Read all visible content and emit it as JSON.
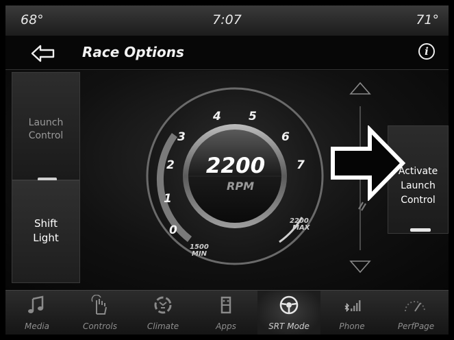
{
  "status": {
    "temp_left": "68°",
    "time": "7:07",
    "temp_right": "71°"
  },
  "header": {
    "title": "Race Options",
    "info_icon": "info-icon",
    "back_icon": "back-arrow-icon"
  },
  "tiles": {
    "launch": {
      "line1": "Launch",
      "line2": "Control"
    },
    "shift": {
      "line1": "Shift",
      "line2": "Light"
    },
    "activate": {
      "line1": "Activate",
      "line2": "Launch",
      "line3": "Control"
    }
  },
  "gauge": {
    "rpm_value": "2200",
    "rpm_unit": "RPM",
    "ticks": [
      "0",
      "1",
      "2",
      "3",
      "4",
      "5",
      "6",
      "7"
    ],
    "min_value": "1500",
    "min_label": "MIN",
    "max_value": "2200",
    "max_label": "MAX"
  },
  "nav": [
    {
      "label": "Media",
      "icon": "music-note-icon"
    },
    {
      "label": "Controls",
      "icon": "hand-touch-icon"
    },
    {
      "label": "Climate",
      "icon": "climate-icon"
    },
    {
      "label": "Apps",
      "icon": "apps-icon"
    },
    {
      "label": "SRT Mode",
      "icon": "steering-wheel-icon"
    },
    {
      "label": "Phone",
      "icon": "phone-signal-icon"
    },
    {
      "label": "PerfPage",
      "icon": "perf-gauge-icon"
    }
  ],
  "colors": {
    "background": "#0c0c0c",
    "text": "#ffffff",
    "muted": "#8e8e8e"
  }
}
